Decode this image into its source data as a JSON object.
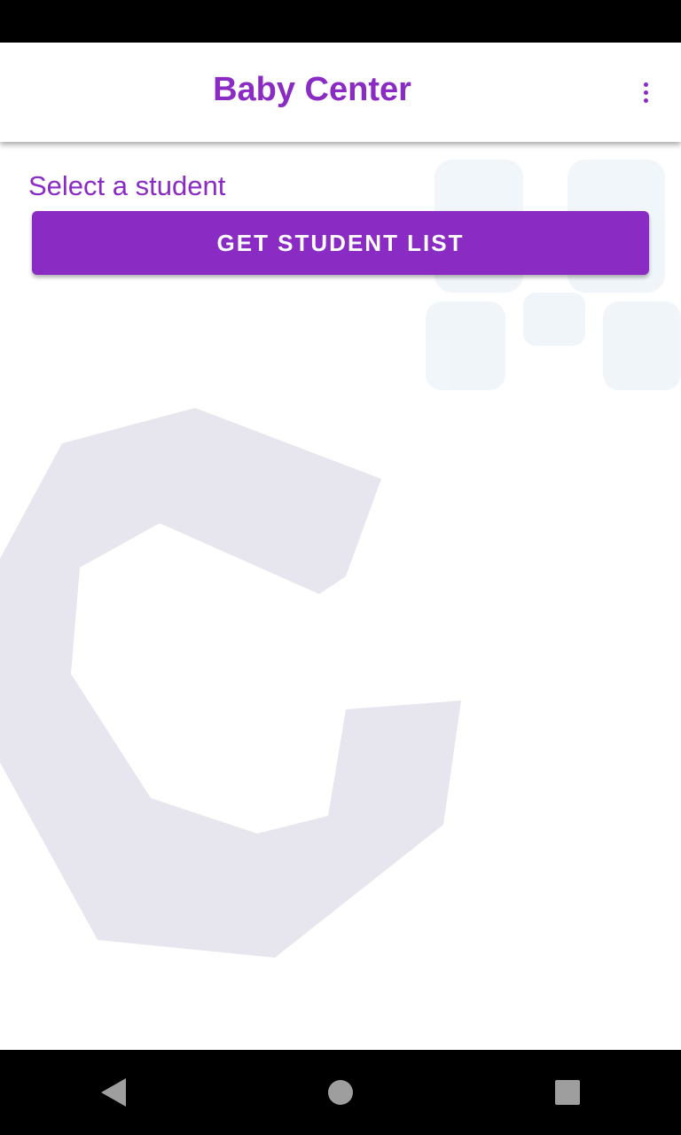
{
  "app_bar": {
    "title": "Baby Center",
    "menu_icon": "more-vert-icon"
  },
  "main": {
    "prompt_label": "Select a student",
    "get_student_list_label": "GET STUDENT LIST"
  },
  "nav_bar": {
    "back_icon": "back-triangle-icon",
    "home_icon": "home-circle-icon",
    "recents_icon": "recents-square-icon"
  },
  "colors": {
    "accent": "#8a2bc4",
    "background": "#ffffff",
    "watermark": "#e7e6ef",
    "system_bar": "#000000",
    "nav_icon": "#9e9e9e"
  }
}
